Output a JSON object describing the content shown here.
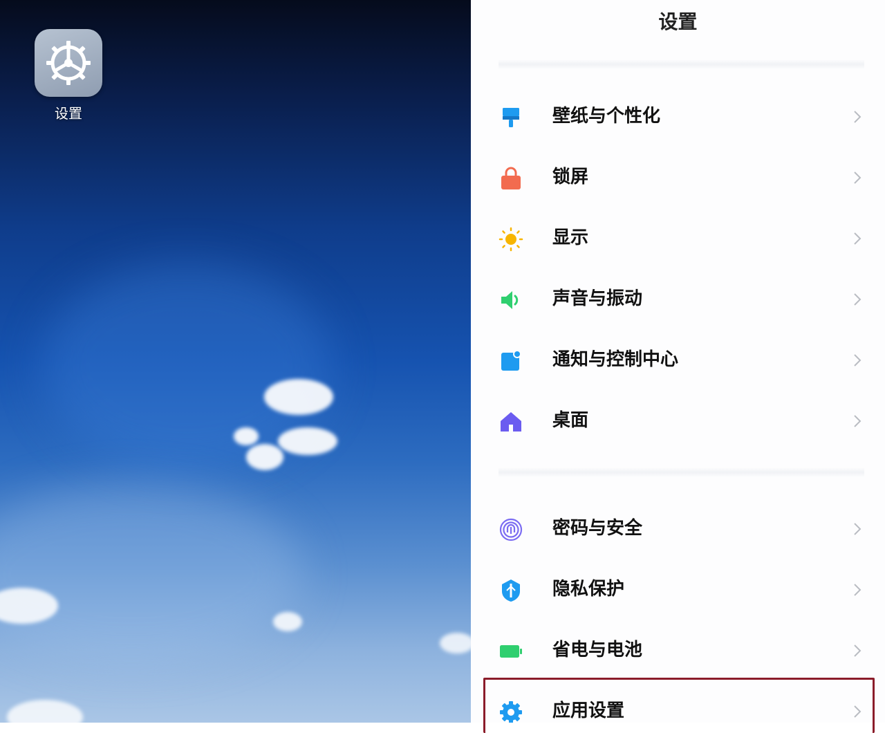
{
  "home": {
    "app_icon": {
      "label": "设置",
      "icon": "gear-icon"
    }
  },
  "settings": {
    "title": "设置",
    "groups": [
      {
        "items": [
          {
            "label": "壁纸与个性化",
            "icon": "paintbrush-icon",
            "color": "#1e9bf0"
          },
          {
            "label": "锁屏",
            "icon": "lock-icon",
            "color": "#f26b4f"
          },
          {
            "label": "显示",
            "icon": "sun-icon",
            "color": "#f7b500"
          },
          {
            "label": "声音与振动",
            "icon": "speaker-icon",
            "color": "#2fcf6f"
          },
          {
            "label": "通知与控制中心",
            "icon": "notification-icon",
            "color": "#1e9bf0"
          },
          {
            "label": "桌面",
            "icon": "home-icon",
            "color": "#6b5cf0"
          }
        ]
      },
      {
        "items": [
          {
            "label": "密码与安全",
            "icon": "fingerprint-icon",
            "color": "#7b6cf2"
          },
          {
            "label": "隐私保护",
            "icon": "shield-icon",
            "color": "#1e9bf0"
          },
          {
            "label": "省电与电池",
            "icon": "battery-icon",
            "color": "#2fcf6f"
          },
          {
            "label": "应用设置",
            "icon": "gear-icon",
            "color": "#1e9bf0",
            "highlighted": true
          }
        ]
      }
    ]
  }
}
